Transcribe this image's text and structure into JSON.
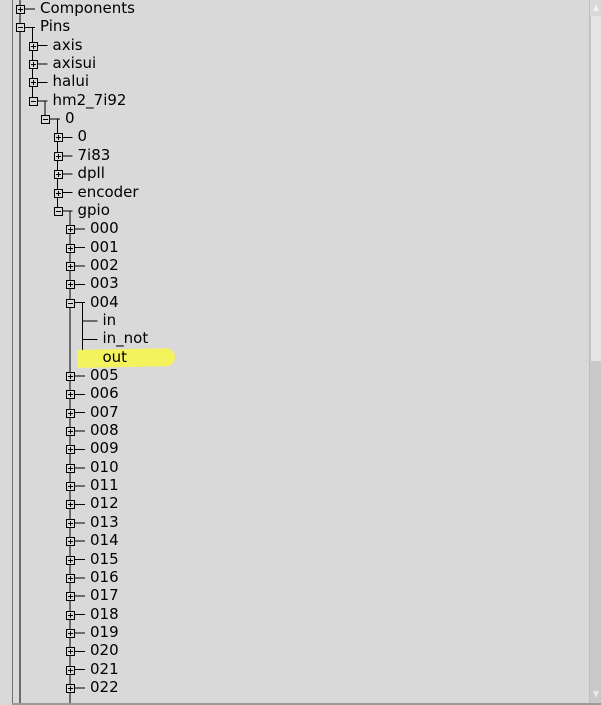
{
  "tree": {
    "nodes": [
      {
        "label": "Components",
        "level": 0,
        "expandable": true,
        "expanded": false
      },
      {
        "label": "Pins",
        "level": 0,
        "expandable": true,
        "expanded": true
      },
      {
        "label": "axis",
        "level": 1,
        "expandable": true,
        "expanded": false
      },
      {
        "label": "axisui",
        "level": 1,
        "expandable": true,
        "expanded": false
      },
      {
        "label": "halui",
        "level": 1,
        "expandable": true,
        "expanded": false
      },
      {
        "label": "hm2_7i92",
        "level": 1,
        "expandable": true,
        "expanded": true
      },
      {
        "label": "0",
        "level": 2,
        "expandable": true,
        "expanded": true
      },
      {
        "label": "0",
        "level": 3,
        "expandable": true,
        "expanded": false
      },
      {
        "label": "7i83",
        "level": 3,
        "expandable": true,
        "expanded": false
      },
      {
        "label": "dpll",
        "level": 3,
        "expandable": true,
        "expanded": false
      },
      {
        "label": "encoder",
        "level": 3,
        "expandable": true,
        "expanded": false
      },
      {
        "label": "gpio",
        "level": 3,
        "expandable": true,
        "expanded": true
      },
      {
        "label": "000",
        "level": 4,
        "expandable": true,
        "expanded": false
      },
      {
        "label": "001",
        "level": 4,
        "expandable": true,
        "expanded": false
      },
      {
        "label": "002",
        "level": 4,
        "expandable": true,
        "expanded": false
      },
      {
        "label": "003",
        "level": 4,
        "expandable": true,
        "expanded": false
      },
      {
        "label": "004",
        "level": 4,
        "expandable": true,
        "expanded": true
      },
      {
        "label": "in",
        "level": 5,
        "expandable": false
      },
      {
        "label": "in_not",
        "level": 5,
        "expandable": false
      },
      {
        "label": "out",
        "level": 5,
        "expandable": false,
        "highlighted": true
      },
      {
        "label": "005",
        "level": 4,
        "expandable": true,
        "expanded": false
      },
      {
        "label": "006",
        "level": 4,
        "expandable": true,
        "expanded": false
      },
      {
        "label": "007",
        "level": 4,
        "expandable": true,
        "expanded": false
      },
      {
        "label": "008",
        "level": 4,
        "expandable": true,
        "expanded": false
      },
      {
        "label": "009",
        "level": 4,
        "expandable": true,
        "expanded": false
      },
      {
        "label": "010",
        "level": 4,
        "expandable": true,
        "expanded": false
      },
      {
        "label": "011",
        "level": 4,
        "expandable": true,
        "expanded": false
      },
      {
        "label": "012",
        "level": 4,
        "expandable": true,
        "expanded": false
      },
      {
        "label": "013",
        "level": 4,
        "expandable": true,
        "expanded": false
      },
      {
        "label": "014",
        "level": 4,
        "expandable": true,
        "expanded": false
      },
      {
        "label": "015",
        "level": 4,
        "expandable": true,
        "expanded": false
      },
      {
        "label": "016",
        "level": 4,
        "expandable": true,
        "expanded": false
      },
      {
        "label": "017",
        "level": 4,
        "expandable": true,
        "expanded": false
      },
      {
        "label": "018",
        "level": 4,
        "expandable": true,
        "expanded": false
      },
      {
        "label": "019",
        "level": 4,
        "expandable": true,
        "expanded": false
      },
      {
        "label": "020",
        "level": 4,
        "expandable": true,
        "expanded": false
      },
      {
        "label": "021",
        "level": 4,
        "expandable": true,
        "expanded": false
      },
      {
        "label": "022",
        "level": 4,
        "expandable": true,
        "expanded": false
      }
    ],
    "highlight_color": "#f4f25d"
  },
  "scrollbar": {
    "up_icon": "arrow-up-icon",
    "down_icon": "arrow-down-icon"
  }
}
